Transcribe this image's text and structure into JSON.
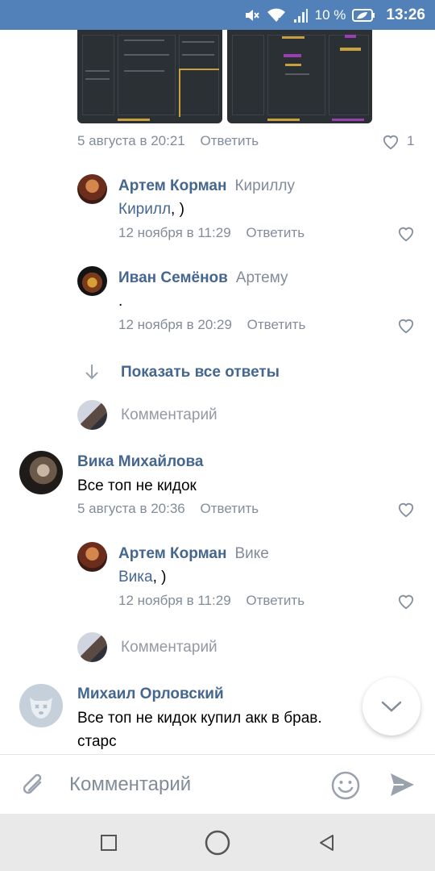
{
  "status_bar": {
    "battery_percent": "10 %",
    "time": "13:26",
    "icons": [
      "mute-icon",
      "wifi-icon",
      "signal-icon",
      "battery-saver-icon"
    ]
  },
  "colors": {
    "accent": "#5181b8",
    "link": "#45678f",
    "secondary": "#818c99"
  },
  "post_images": {
    "top_comment_meta": {
      "time": "5 августа в 20:21",
      "reply": "Ответить",
      "likes": "1"
    }
  },
  "comments": [
    {
      "author": "Артем Корман",
      "reply_to": "Кириллу",
      "mention": "Кирилл",
      "text": ", )",
      "time": "12 ноября в 11:29",
      "reply": "Ответить"
    },
    {
      "author": "Иван Семёнов",
      "reply_to": "Артему",
      "text": ".",
      "time": "12 ноября в 20:29",
      "reply": "Ответить"
    },
    {
      "show_all": "Показать все ответы",
      "comment_placeholder": "Комментарий"
    },
    {
      "author": "Вика Михайлова",
      "text": "Все топ не кидок",
      "time": "5 августа в 20:36",
      "reply": "Ответить"
    },
    {
      "author": "Артем Корман",
      "reply_to": "Вике",
      "mention": "Вика",
      "text": ", )",
      "time": "12 ноября в 11:29",
      "reply": "Ответить"
    },
    {
      "comment_placeholder": "Комментарий"
    },
    {
      "author": "Михаил Орловский",
      "text_line1": "Все топ не кидок купил акк в брав.",
      "text_line2": "старс"
    }
  ],
  "input_bar": {
    "placeholder": "Комментарий",
    "icons": [
      "attach-icon",
      "emoji-icon",
      "send-icon"
    ]
  },
  "nav_bar": {
    "icons": [
      "recents-icon",
      "home-icon",
      "back-icon"
    ]
  }
}
